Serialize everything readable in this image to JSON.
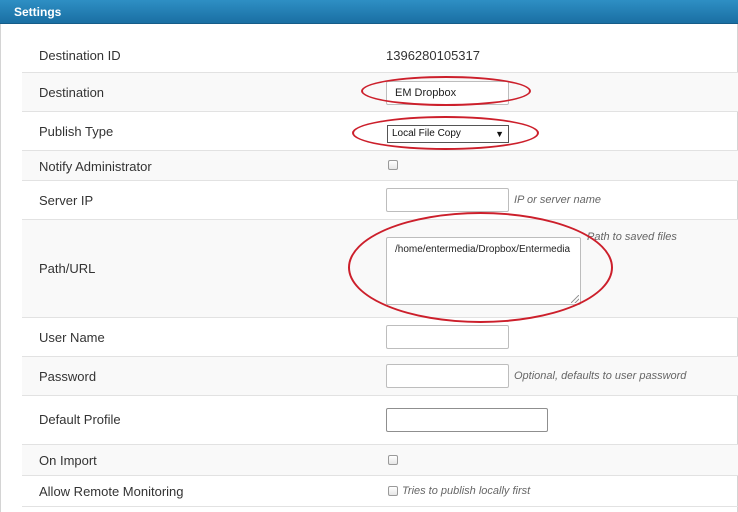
{
  "header": {
    "title": "Settings"
  },
  "fields": {
    "destination_id": {
      "label": "Destination ID",
      "value": "1396280105317"
    },
    "destination": {
      "label": "Destination",
      "value": "EM Dropbox"
    },
    "publish_type": {
      "label": "Publish Type",
      "value": "Local File Copy",
      "arrow": "▼"
    },
    "notify_admin": {
      "label": "Notify Administrator",
      "checked": false
    },
    "server_ip": {
      "label": "Server IP",
      "value": "",
      "hint": "IP or server name"
    },
    "path_url": {
      "label": "Path/URL",
      "value": "/home/entermedia/Dropbox/Entermedia",
      "hint": "Path to saved files"
    },
    "user_name": {
      "label": "User Name",
      "value": ""
    },
    "password": {
      "label": "Password",
      "value": "",
      "hint": "Optional, defaults to user password"
    },
    "default_profile": {
      "label": "Default Profile",
      "value": ""
    },
    "on_import": {
      "label": "On Import",
      "checked": false
    },
    "remote_monitoring": {
      "label": "Allow Remote Monitoring",
      "checked": false,
      "hint": "Tries to publish locally first"
    }
  },
  "annotation_color": "#cc1f2b",
  "header_color": "#1f7cb4"
}
